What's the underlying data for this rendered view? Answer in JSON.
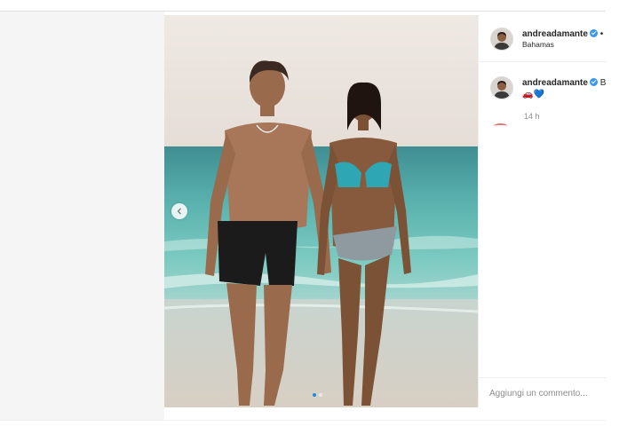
{
  "post": {
    "author": {
      "username": "andreadamante",
      "verified": true,
      "location": "Bahamas",
      "separator": "•"
    },
    "caption": {
      "username": "andreadamante",
      "text_start": "B",
      "emojis": "🚗💙"
    },
    "timestamp": "14 h",
    "comment_placeholder": "Aggiungi un commento...",
    "carousel": {
      "total_slides": 2,
      "current_slide": 1
    },
    "icons": {
      "prev": "chevron-left-icon",
      "verified": "verified-badge-icon"
    },
    "colors": {
      "verified": "#3897f0",
      "active_dot": "#1e88e5",
      "link": "#262626"
    }
  }
}
